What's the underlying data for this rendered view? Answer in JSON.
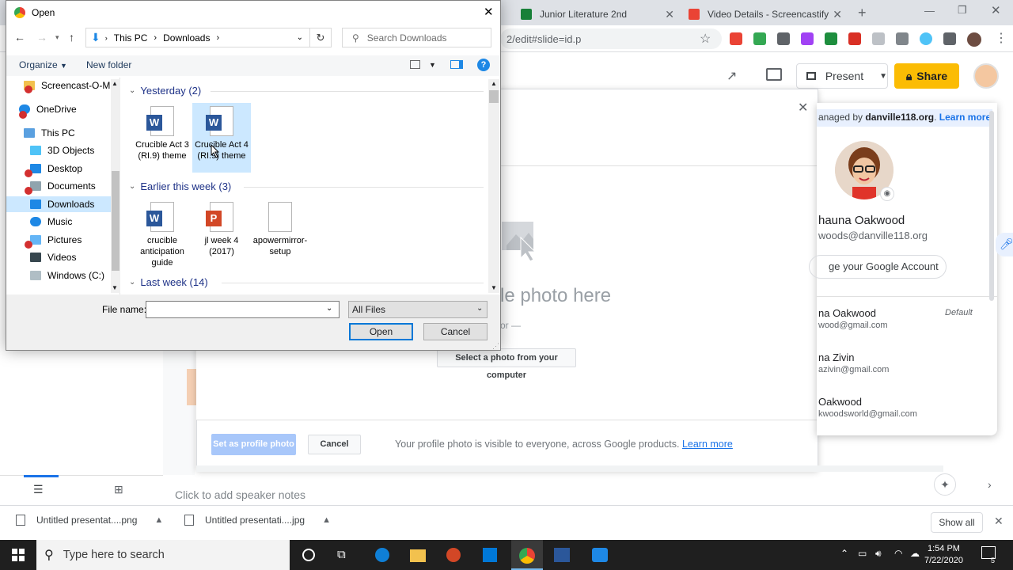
{
  "browser": {
    "tabs": [
      {
        "title": "Junior Literature 2nd"
      },
      {
        "title": "Video Details - Screencastify"
      }
    ],
    "url": "2/edit#slide=id.p"
  },
  "slides": {
    "present_label": "Present",
    "share_label": "Share",
    "notes_placeholder": "Click to add speaker notes"
  },
  "photo_modal": {
    "drop_text": "le photo here",
    "or_text": "or —",
    "select_button": "Select a photo from your computer",
    "set_button": "Set as profile photo",
    "cancel_button": "Cancel",
    "footer_note": "Your profile photo is visible to everyone, across Google products.",
    "learn_more": "Learn more"
  },
  "account_panel": {
    "managed_prefix": "anaged by ",
    "managed_domain": "danville118.org",
    "managed_dot": ".",
    "learn_more": "Learn more",
    "name": "hauna Oakwood",
    "email": "woods@danville118.org",
    "manage_button": "ge your Google Account",
    "accounts": [
      {
        "name": "na Oakwood",
        "email": "wood@gmail.com",
        "tag": "Default"
      },
      {
        "name": "na Zivin",
        "email": "azivin@gmail.com"
      },
      {
        "name": "Oakwood",
        "email": "kwoodsworld@gmail.com"
      }
    ]
  },
  "downloads": {
    "items": [
      {
        "name": "Untitled presentat....png"
      },
      {
        "name": "Untitled presentati....jpg"
      }
    ],
    "show_all": "Show all"
  },
  "taskbar": {
    "search_placeholder": "Type here to search",
    "time": "1:54 PM",
    "date": "7/22/2020",
    "notification_count": "5"
  },
  "dialog": {
    "title": "Open",
    "breadcrumb": [
      "This PC",
      "Downloads"
    ],
    "search_placeholder": "Search Downloads",
    "organize": "Organize",
    "new_folder": "New folder",
    "nav_items": [
      {
        "label": "Screencast-O-M"
      },
      {
        "label": "OneDrive"
      },
      {
        "label": "This PC"
      },
      {
        "label": "3D Objects"
      },
      {
        "label": "Desktop"
      },
      {
        "label": "Documents"
      },
      {
        "label": "Downloads"
      },
      {
        "label": "Music"
      },
      {
        "label": "Pictures"
      },
      {
        "label": "Videos"
      },
      {
        "label": "Windows (C:)"
      }
    ],
    "groups": [
      {
        "header": "Yesterday (2)",
        "files": [
          {
            "name": "Crucible Act 3 (RI.9) theme",
            "type": "word"
          },
          {
            "name": "Crucible Act 4 (RI.9) theme",
            "type": "word"
          }
        ]
      },
      {
        "header": "Earlier this week (3)",
        "files": [
          {
            "name": "crucible anticipation guide",
            "type": "word"
          },
          {
            "name": "jl week 4 (2017)",
            "type": "powerpoint"
          },
          {
            "name": "apowermirror-setup",
            "type": "blank"
          }
        ]
      },
      {
        "header": "Last week (14)",
        "files": []
      }
    ],
    "file_name_label": "File name:",
    "file_name_value": "",
    "file_type": "All Files",
    "open_button": "Open",
    "cancel_button": "Cancel"
  }
}
